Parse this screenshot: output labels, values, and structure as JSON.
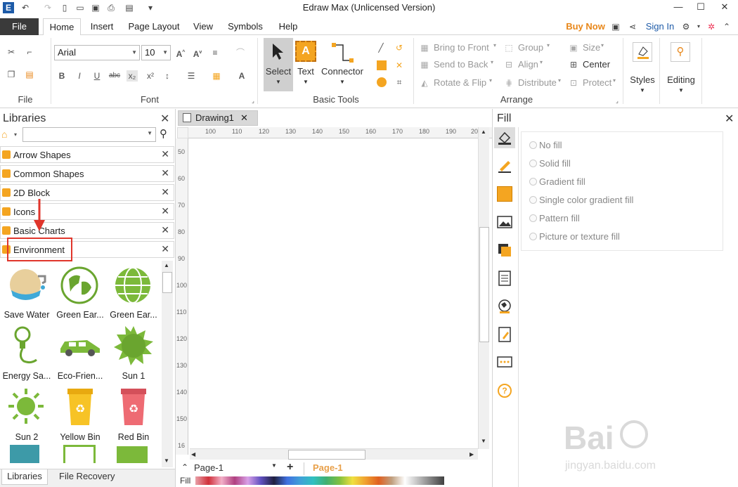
{
  "window": {
    "title": "Edraw Max (Unlicensed Version)"
  },
  "tabs": {
    "file": "File",
    "items": [
      "Home",
      "Insert",
      "Page Layout",
      "View",
      "Symbols",
      "Help"
    ],
    "buy_now": "Buy Now",
    "sign_in": "Sign In"
  },
  "ribbon": {
    "file_group": "File",
    "font_group": "Font",
    "font_name": "Arial",
    "font_size": "10",
    "basic_tools_group": "Basic Tools",
    "select": "Select",
    "text": "Text",
    "connector": "Connector",
    "arrange_group": "Arrange",
    "bring_to_front": "Bring to Front",
    "send_to_back": "Send to Back",
    "rotate_flip": "Rotate & Flip",
    "group": "Group",
    "align": "Align",
    "distribute": "Distribute",
    "size": "Size",
    "center": "Center",
    "protect": "Protect",
    "styles": "Styles",
    "editing": "Editing"
  },
  "libraries": {
    "title": "Libraries",
    "items": [
      "Arrow Shapes",
      "Common Shapes",
      "2D Block",
      "Icons",
      "Basic Charts",
      "Environment"
    ],
    "shapes": [
      "Save Water",
      "Green Ear...",
      "Green Ear...",
      "Energy Sa...",
      "Eco-Frien...",
      "Sun 1",
      "Sun 2",
      "Yellow Bin",
      "Red Bin"
    ],
    "bottom_tabs": [
      "Libraries",
      "File Recovery"
    ]
  },
  "document": {
    "tab": "Drawing1",
    "ruler_h": [
      "100",
      "110",
      "120",
      "130",
      "140",
      "150",
      "160",
      "170",
      "180",
      "190",
      "20"
    ],
    "ruler_v": [
      "50",
      "60",
      "70",
      "80",
      "90",
      "100",
      "110",
      "120",
      "130",
      "140",
      "150",
      "16"
    ],
    "page_select": "Page-1",
    "page_tab": "Page-1",
    "fill_label": "Fill"
  },
  "fill_panel": {
    "title": "Fill",
    "options": [
      "No fill",
      "Solid fill",
      "Gradient fill",
      "Single color gradient fill",
      "Pattern fill",
      "Picture or texture fill"
    ]
  },
  "watermark": {
    "line1": "Bai",
    "line2": "jingyan.baidu.com"
  },
  "colors": {
    "accent": "#f4a521",
    "file_tab_bg": "#3a3a3a",
    "highlight_red": "#e0352b"
  }
}
